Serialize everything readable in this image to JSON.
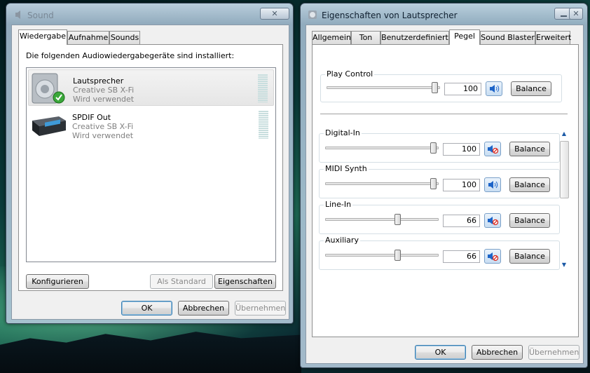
{
  "sound_window": {
    "title": "Sound",
    "tabs": [
      "Wiedergabe",
      "Aufnahme",
      "Sounds"
    ],
    "intro": "Die folgenden Audiowiedergabegeräte sind installiert:",
    "devices": [
      {
        "name": "Lautsprecher",
        "vendor": "Creative SB X-Fi",
        "status": "Wird verwendet",
        "icon": "speaker-icon",
        "default": true
      },
      {
        "name": "SPDIF Out",
        "vendor": "Creative SB X-Fi",
        "status": "Wird verwendet",
        "icon": "spdif-device-icon",
        "default": false
      }
    ],
    "buttons": {
      "configure": "Konfigurieren",
      "set_default": "Als Standard",
      "properties": "Eigenschaften",
      "ok": "OK",
      "cancel": "Abbrechen",
      "apply": "Übernehmen"
    }
  },
  "props_window": {
    "title": "Eigenschaften von Lautsprecher",
    "tabs": [
      "Allgemein",
      "Ton",
      "Benutzerdefiniert",
      "Pegel",
      "Sound Blaster",
      "Erweitert"
    ],
    "active_tab": "Pegel",
    "master": {
      "label": "Play Control",
      "value": "100",
      "level": 1.0,
      "muted": false,
      "balance": "Balance"
    },
    "channels": [
      {
        "label": "Digital-In",
        "value": "100",
        "level": 1.0,
        "muted": true,
        "balance": "Balance"
      },
      {
        "label": "MIDI Synth",
        "value": "100",
        "level": 1.0,
        "muted": false,
        "balance": "Balance"
      },
      {
        "label": "Line-In",
        "value": "66",
        "level": 0.66,
        "muted": true,
        "balance": "Balance"
      },
      {
        "label": "Auxiliary",
        "value": "66",
        "level": 0.66,
        "muted": true,
        "balance": "Balance"
      }
    ],
    "buttons": {
      "ok": "OK",
      "cancel": "Abbrechen",
      "apply": "Übernehmen"
    }
  },
  "colors": {
    "accent": "#3c7fb1",
    "mute_red": "#d9261c",
    "speaker_blue": "#1c64c8"
  }
}
